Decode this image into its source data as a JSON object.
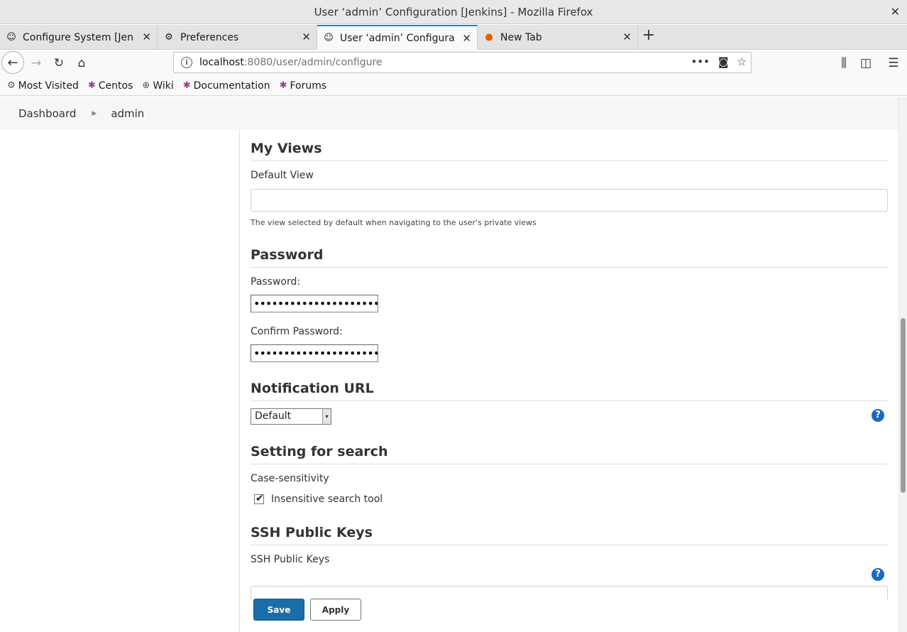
{
  "window": {
    "title": "User ‘admin’ Configuration [Jenkins] - Mozilla Firefox"
  },
  "tabs": [
    {
      "label": "Configure System [Jenkins]",
      "icon": "jenkins-icon",
      "active": false
    },
    {
      "label": "Preferences",
      "icon": "gear-icon",
      "active": false
    },
    {
      "label": "User ‘admin’ Configuration",
      "icon": "jenkins-icon",
      "active": true
    },
    {
      "label": "New Tab",
      "icon": "firefox-icon",
      "active": false
    }
  ],
  "nav": {
    "url_host": "localhost",
    "url_rest": ":8080/user/admin/configure"
  },
  "bookmarks": [
    {
      "label": "Most Visited",
      "icon": "gear-icon"
    },
    {
      "label": "Centos",
      "icon": "centos-icon"
    },
    {
      "label": "Wiki",
      "icon": "globe-icon"
    },
    {
      "label": "Documentation",
      "icon": "centos-icon"
    },
    {
      "label": "Forums",
      "icon": "centos-icon"
    }
  ],
  "breadcrumb": {
    "items": [
      "Dashboard",
      "admin"
    ]
  },
  "sections": {
    "my_views": {
      "title": "My Views",
      "default_view_label": "Default View",
      "default_view_value": "",
      "description": "The view selected by default when navigating to the user's private views"
    },
    "password": {
      "title": "Password",
      "password_label": "Password:",
      "password_value": "••••••••••••••••••••••",
      "confirm_label": "Confirm Password:",
      "confirm_value": "••••••••••••••••••••••"
    },
    "notification": {
      "title": "Notification URL",
      "selected": "Default"
    },
    "search": {
      "title": "Setting for search",
      "case_label": "Case-sensitivity",
      "checkbox_label": "Insensitive search tool",
      "checked": true
    },
    "ssh": {
      "title": "SSH Public Keys",
      "label": "SSH Public Keys"
    }
  },
  "buttons": {
    "save": "Save",
    "apply": "Apply"
  },
  "colors": {
    "accent_tab": "#0a84ff",
    "save_button": "#1a6ea7",
    "help": "#1b6ac0"
  }
}
